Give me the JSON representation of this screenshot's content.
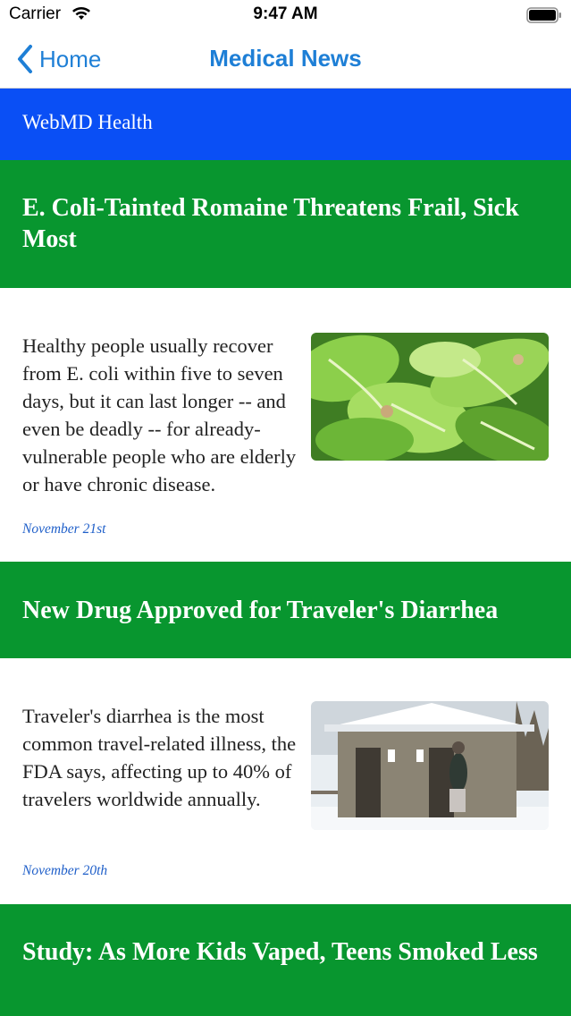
{
  "status": {
    "carrier": "Carrier",
    "time": "9:47 AM"
  },
  "nav": {
    "back_label": "Home",
    "title": "Medical News"
  },
  "source": {
    "label": "WebMD Health"
  },
  "articles": [
    {
      "title": "E. Coli-Tainted Romaine Threatens Frail, Sick Most",
      "summary": "Healthy people usually recover from E. coli within five to seven days, but it can last longer -- and even be deadly -- for already-vulnerable people who are elderly or have chronic disease.",
      "date": "November 21st",
      "image": "romaine-lettuce"
    },
    {
      "title": "New Drug Approved for Traveler's Diarrhea",
      "summary": "Traveler's diarrhea is the most common travel-related illness, the FDA says, affecting up to 40% of travelers worldwide annually.",
      "date": "November 20th",
      "image": "outhouse-in-snow"
    },
    {
      "title": "Study: As More Kids Vaped, Teens Smoked Less"
    }
  ],
  "colors": {
    "accent": "#1e7fd6",
    "source_bg": "#0a4ff5",
    "title_bg": "#08962f",
    "date": "#1f5fc9"
  }
}
